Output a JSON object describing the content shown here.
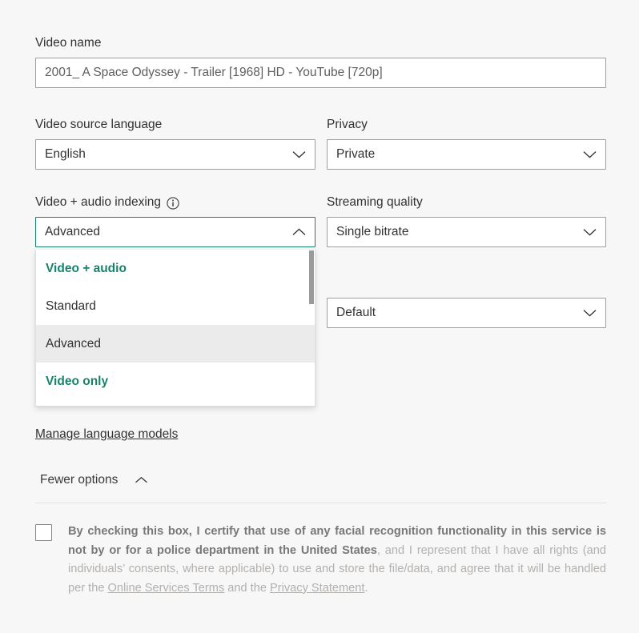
{
  "form": {
    "video_name": {
      "label": "Video name",
      "value": "2001_ A Space Odyssey - Trailer [1968] HD - YouTube [720p]"
    },
    "source_language": {
      "label": "Video source language",
      "value": "English",
      "chevron": "chevron-down-icon"
    },
    "privacy": {
      "label": "Privacy",
      "value": "Private",
      "chevron": "chevron-down-icon"
    },
    "indexing": {
      "label": "Video + audio indexing",
      "info_icon": "info-icon",
      "value": "Advanced",
      "chevron": "chevron-up-icon",
      "expanded": true,
      "options": [
        {
          "label": "Video + audio",
          "style": "header",
          "selected": false
        },
        {
          "label": "Standard",
          "style": "normal",
          "selected": false
        },
        {
          "label": "Advanced",
          "style": "normal",
          "selected": true
        },
        {
          "label": "Video only",
          "style": "header",
          "selected": false
        }
      ]
    },
    "streaming_quality": {
      "label": "Streaming quality",
      "value": "Single bitrate",
      "chevron": "chevron-down-icon"
    },
    "extra_select": {
      "value": "Default",
      "chevron": "chevron-down-icon"
    }
  },
  "links": {
    "manage_language_models": "Manage language models"
  },
  "toggle": {
    "label": "Fewer options",
    "chevron": "chevron-up-icon"
  },
  "consent": {
    "bold_part": "By checking this box, I certify that use of any facial recognition functionality in this service is not by or for a police department in the United States",
    "rest_1": ", and I represent that I have all rights (and individuals’ consents, where applicable) to use and store the file/data, and agree that it will be handled per the ",
    "link_terms": "Online Services Terms",
    "rest_2": " and the ",
    "link_privacy": "Privacy Statement",
    "rest_3": ".",
    "checked": false
  },
  "colors": {
    "accent_green": "#17836c",
    "page_background": "#f7f7f7",
    "field_border": "#a19f9d",
    "selected_row": "#ebebeb",
    "muted_text": "#b3b0ad"
  }
}
